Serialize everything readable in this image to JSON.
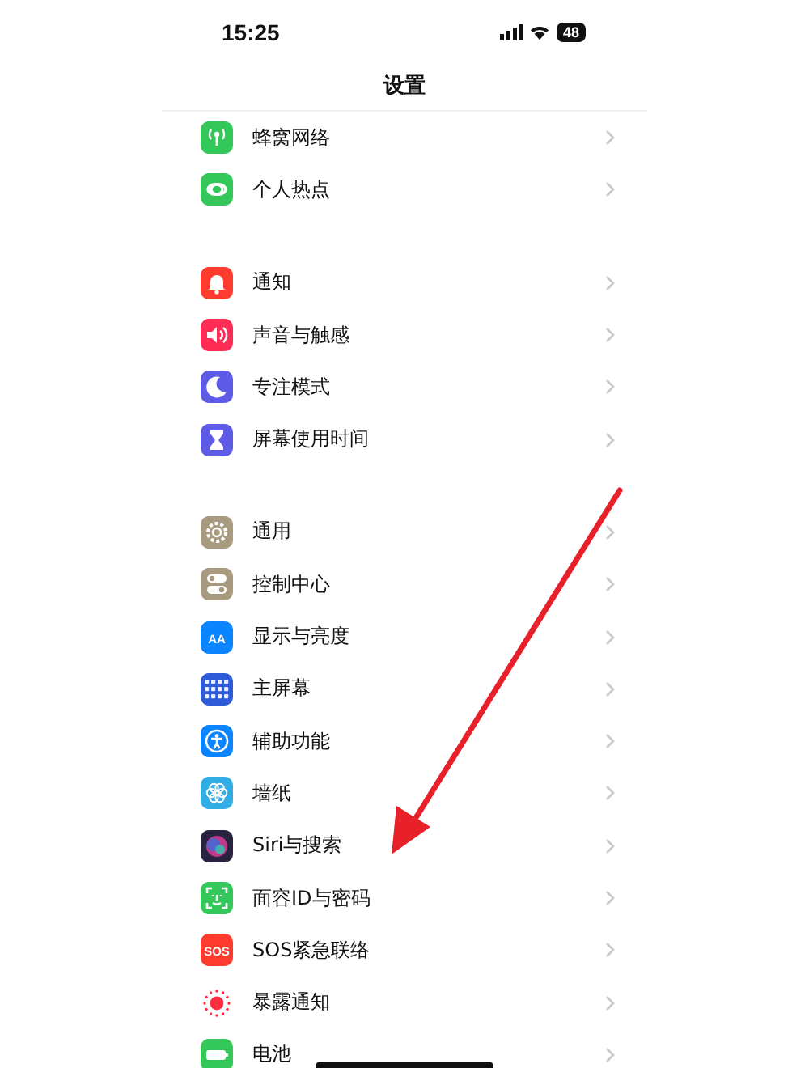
{
  "status_bar": {
    "time": "15:25",
    "battery": "48"
  },
  "title": "设置",
  "groups": [
    {
      "items": [
        {
          "label": "蜂窝网络",
          "kind": "antenna",
          "color": "#34c759"
        },
        {
          "label": "个人热点",
          "kind": "hotspot",
          "color": "#34c759"
        }
      ]
    },
    {
      "items": [
        {
          "label": "通知",
          "kind": "bell",
          "color": "#ff3b30"
        },
        {
          "label": "声音与触感",
          "kind": "speaker",
          "color": "#ff2d55"
        },
        {
          "label": "专注模式",
          "kind": "moon",
          "color": "#5e5ce6"
        },
        {
          "label": "屏幕使用时间",
          "kind": "hourglass",
          "color": "#5e5ce6"
        }
      ]
    },
    {
      "items": [
        {
          "label": "通用",
          "kind": "gear",
          "color": "#a79a7f"
        },
        {
          "label": "控制中心",
          "kind": "toggles",
          "color": "#a79a7f"
        },
        {
          "label": "显示与亮度",
          "kind": "text",
          "icon_text": "AA",
          "color": "#0a84ff"
        },
        {
          "label": "主屏幕",
          "kind": "grid",
          "color": "#2f5bd8"
        },
        {
          "label": "辅助功能",
          "kind": "person",
          "color": "#0a84ff"
        },
        {
          "label": "墙纸",
          "kind": "flower",
          "color": "#32ade6"
        },
        {
          "label": "Siri与搜索",
          "kind": "siri",
          "color": "#2a2340"
        },
        {
          "label": "面容ID与密码",
          "kind": "face",
          "color": "#34c759"
        },
        {
          "label": "SOS紧急联络",
          "kind": "text",
          "icon_text": "SOS",
          "color": "#ff3b30"
        },
        {
          "label": "暴露通知",
          "kind": "exposure",
          "color": "#ffffff"
        },
        {
          "label": "电池",
          "kind": "battery",
          "color": "#34c759"
        }
      ]
    }
  ]
}
